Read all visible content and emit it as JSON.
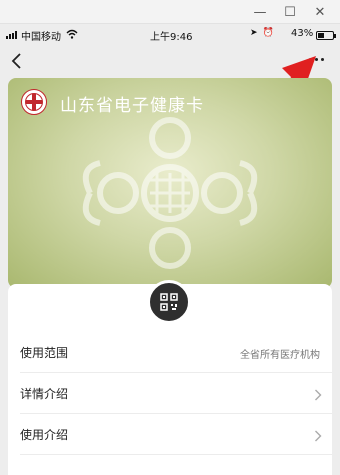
{
  "window": {
    "minimize_glyph": "—",
    "maximize_glyph": "☐",
    "close_glyph": "✕"
  },
  "status_bar": {
    "carrier": "中国移动",
    "time": "上午9:46",
    "battery_percent": "43%",
    "battery_level": 0.43
  },
  "nav": {
    "back_icon": "chevron-left-icon",
    "more_icon": "more-dots-icon"
  },
  "card": {
    "title": "山东省电子健康卡",
    "colors": {
      "background": "#cfd7a6",
      "logo": "#c1272d"
    }
  },
  "qr": {
    "icon": "qr-code-icon"
  },
  "list": {
    "items": [
      {
        "label": "使用范围",
        "value": "全省所有医疗机构"
      },
      {
        "label": "详情介绍",
        "value": ""
      },
      {
        "label": "使用介绍",
        "value": ""
      }
    ]
  },
  "annotation": {
    "arrow_color": "#e02020"
  }
}
